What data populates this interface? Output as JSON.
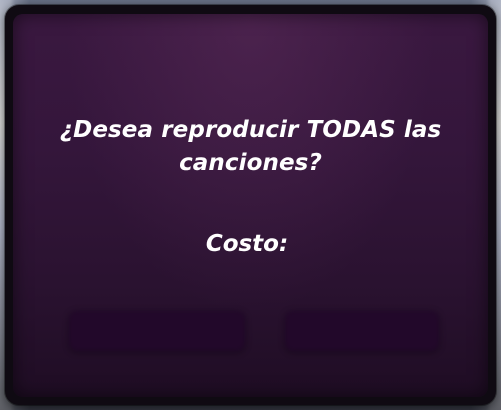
{
  "dialog": {
    "question": "¿Desea reproducir TODAS las canciones?",
    "cost_label": "Costo:",
    "cost_value": ""
  },
  "buttons": {
    "confirm_label": "",
    "cancel_label": ""
  },
  "colors": {
    "panel": "#34163b",
    "button": "#22082a",
    "text": "#ffffff"
  }
}
